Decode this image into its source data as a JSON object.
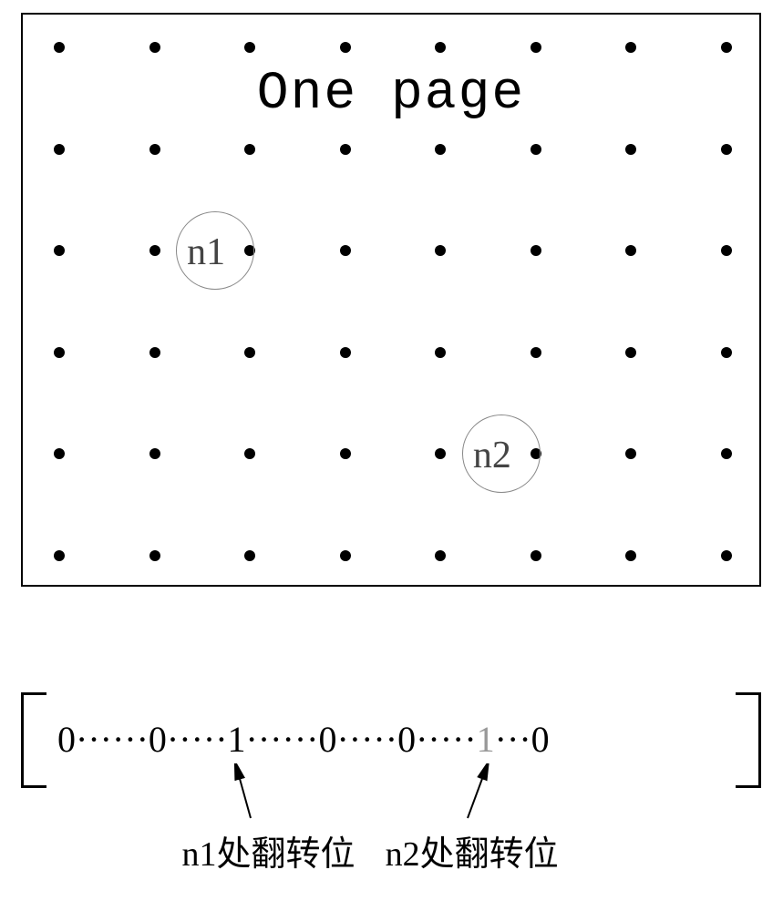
{
  "grid": {
    "title": "One page",
    "rows": 6,
    "cols": 8,
    "markers": [
      {
        "id": "n1",
        "row": 2,
        "col": 2,
        "label": "n1"
      },
      {
        "id": "n2",
        "row": 4,
        "col": 5,
        "label": "n2"
      }
    ]
  },
  "bitvector": {
    "segments": [
      "0",
      "······",
      "0",
      "·····",
      "1",
      "······",
      "0",
      "·····",
      "0",
      "·····",
      "1",
      "···",
      "0"
    ],
    "flip_positions": [
      {
        "index": 4,
        "label": "n1处翻转位"
      },
      {
        "index": 10,
        "label": "n2处翻转位"
      }
    ]
  }
}
